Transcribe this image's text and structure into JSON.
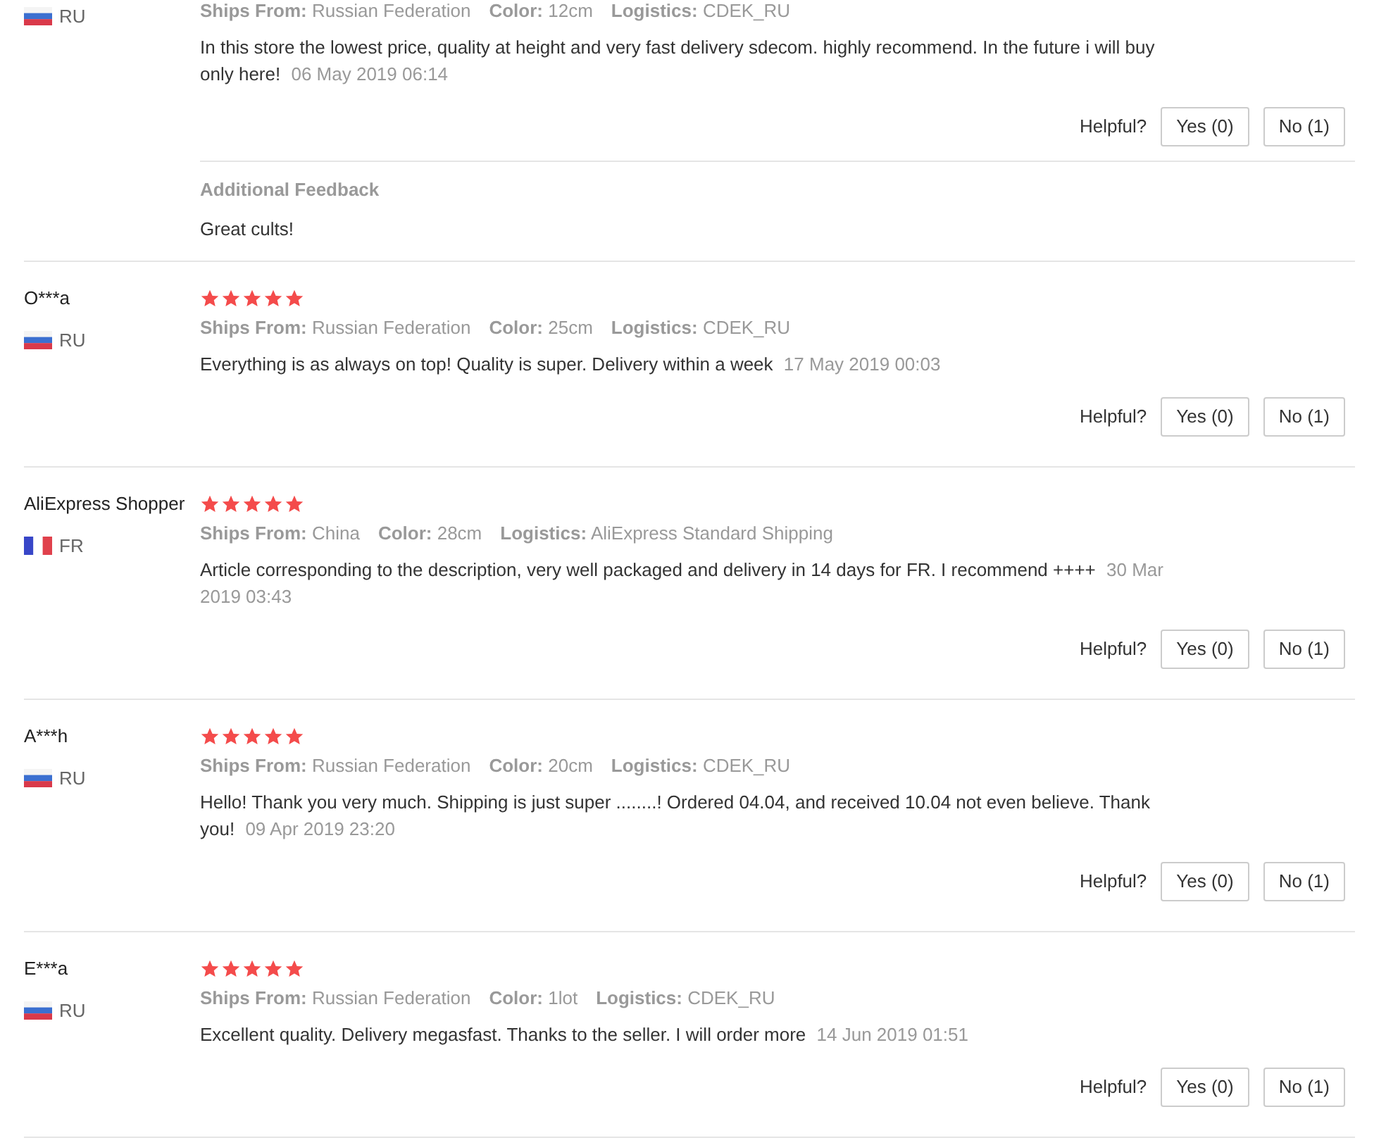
{
  "reviews": [
    {
      "country": {
        "kind": "russia",
        "code": "RU"
      },
      "ships_from": {
        "label": "Ships From:",
        "value": "Russian Federation"
      },
      "color": {
        "label": "Color:",
        "value": "12cm"
      },
      "logistics": {
        "label": "Logistics:",
        "value": "CDEK_RU"
      },
      "text": "In this store the lowest price, quality at height and very fast delivery sdecom. highly recommend. In the future i will buy only here!",
      "date": "06 May 2019 06:14",
      "helpful": "Helpful?",
      "yes": "Yes (0)",
      "no": "No (1)",
      "additional": {
        "title": "Additional Feedback",
        "text": "Great cults!"
      }
    },
    {
      "name": "O***a",
      "country": {
        "kind": "russia",
        "code": "RU"
      },
      "stars": 5,
      "ships_from": {
        "label": "Ships From:",
        "value": "Russian Federation"
      },
      "color": {
        "label": "Color:",
        "value": "25cm"
      },
      "logistics": {
        "label": "Logistics:",
        "value": "CDEK_RU"
      },
      "text": "Everything is as always on top! Quality is super. Delivery within a week",
      "date": "17 May 2019 00:03",
      "helpful": "Helpful?",
      "yes": "Yes (0)",
      "no": "No (1)"
    },
    {
      "name": "AliExpress Shopper",
      "country": {
        "kind": "france",
        "code": "FR"
      },
      "stars": 5,
      "ships_from": {
        "label": "Ships From:",
        "value": "China"
      },
      "color": {
        "label": "Color:",
        "value": "28cm"
      },
      "logistics": {
        "label": "Logistics:",
        "value": "AliExpress Standard Shipping"
      },
      "text": "Article corresponding to the description, very well packaged and delivery in 14 days for FR. I recommend ++++",
      "date": "30 Mar 2019 03:43",
      "helpful": "Helpful?",
      "yes": "Yes (0)",
      "no": "No (1)"
    },
    {
      "name": "A***h",
      "country": {
        "kind": "russia",
        "code": "RU"
      },
      "stars": 5,
      "ships_from": {
        "label": "Ships From:",
        "value": "Russian Federation"
      },
      "color": {
        "label": "Color:",
        "value": "20cm"
      },
      "logistics": {
        "label": "Logistics:",
        "value": "CDEK_RU"
      },
      "text": "Hello! Thank you very much. Shipping is just super ........! Ordered 04.04, and received 10.04 not even believe. Thank you!",
      "date": "09 Apr 2019 23:20",
      "helpful": "Helpful?",
      "yes": "Yes (0)",
      "no": "No (1)"
    },
    {
      "name": "E***a",
      "country": {
        "kind": "russia",
        "code": "RU"
      },
      "stars": 5,
      "ships_from": {
        "label": "Ships From:",
        "value": "Russian Federation"
      },
      "color": {
        "label": "Color:",
        "value": "1lot"
      },
      "logistics": {
        "label": "Logistics:",
        "value": "CDEK_RU"
      },
      "text": "Excellent quality. Delivery megasfast. Thanks to the seller. I will order more",
      "date": "14 Jun 2019 01:51",
      "helpful": "Helpful?",
      "yes": "Yes (0)",
      "no": "No (1)"
    }
  ]
}
